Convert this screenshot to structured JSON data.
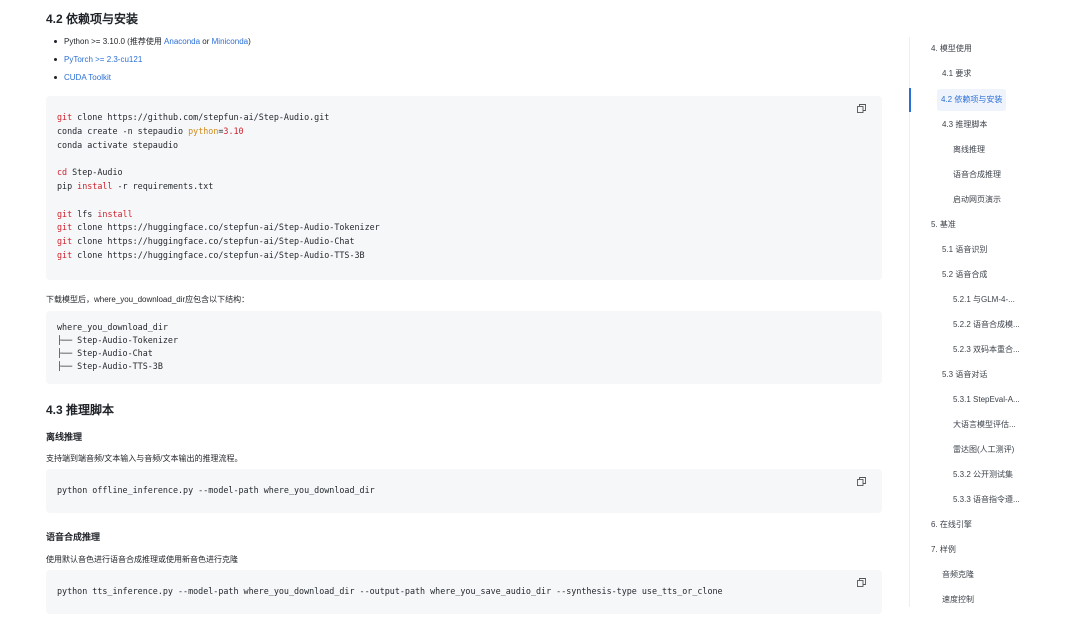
{
  "section_42": {
    "title": "4.2 依赖项与安装",
    "bullets": [
      {
        "prefix": "Python >= 3.10.0 (推荐使用 ",
        "link1": "Anaconda",
        "mid": " or ",
        "link2": "Miniconda",
        "suffix": ")"
      },
      {
        "link": "PyTorch >= 2.3-cu121"
      },
      {
        "link": "CUDA Toolkit"
      }
    ],
    "download_note": "下载模型后，where_you_download_dir应包含以下结构：",
    "tree": [
      "where_you_download_dir",
      "├── Step-Audio-Tokenizer",
      "├── Step-Audio-Chat",
      "├── Step-Audio-TTS-3B"
    ]
  },
  "install_code": {
    "l1_cmd": "git",
    "l1_rest": " clone https://github.com/stepfun-ai/Step-Audio.git",
    "l2_a": "conda create -n stepaudio ",
    "l2_kw": "python",
    "l2_eq": "=",
    "l2_num": "3.10",
    "l3": "conda activate stepaudio",
    "l4_cmd": "cd",
    "l4_rest": " Step-Audio",
    "l5_a": "pip ",
    "l5_kw": "install",
    "l5_rest": " -r requirements.txt",
    "l6_cmd": "git",
    "l6_rest": " lfs ",
    "l6_kw": "install",
    "l7_cmd": "git",
    "l7_rest": " clone https://huggingface.co/stepfun-ai/Step-Audio-Tokenizer",
    "l8_cmd": "git",
    "l8_rest": " clone https://huggingface.co/stepfun-ai/Step-Audio-Chat",
    "l9_cmd": "git",
    "l9_rest": " clone https://huggingface.co/stepfun-ai/Step-Audio-TTS-3B"
  },
  "section_43": {
    "title": "4.3 推理脚本",
    "offline_title": "离线推理",
    "offline_desc": "支持端到端音频/文本输入与音频/文本输出的推理流程。",
    "offline_cmd": "python offline_inference.py --model-path where_you_download_dir",
    "tts_title": "语音合成推理",
    "tts_desc": "使用默认音色进行语音合成推理或使用新音色进行克隆",
    "tts_cmd": "python tts_inference.py --model-path where_you_download_dir --output-path where_you_save_audio_dir --synthesis-type use_tts_or_clone"
  },
  "toc": [
    {
      "label": "4. 模型使用",
      "level": 0
    },
    {
      "label": "4.1 要求",
      "level": 1
    },
    {
      "label": "4.2 依赖项与安装",
      "level": 1,
      "active": true
    },
    {
      "label": "4.3 推理脚本",
      "level": 1
    },
    {
      "label": "离线推理",
      "level": 2
    },
    {
      "label": "语音合成推理",
      "level": 2
    },
    {
      "label": "启动网页演示",
      "level": 2
    },
    {
      "label": "5. 基准",
      "level": 0
    },
    {
      "label": "5.1 语音识别",
      "level": 1
    },
    {
      "label": "5.2 语音合成",
      "level": 1
    },
    {
      "label": "5.2.1 与GLM-4-...",
      "level": 2
    },
    {
      "label": "5.2.2 语音合成模...",
      "level": 2
    },
    {
      "label": "5.2.3 双码本重合...",
      "level": 2
    },
    {
      "label": "5.3 语音对话",
      "level": 1
    },
    {
      "label": "5.3.1 StepEval-A...",
      "level": 2
    },
    {
      "label": "大语言模型评估...",
      "level": 2
    },
    {
      "label": "雷达图(人工测评)",
      "level": 2
    },
    {
      "label": "5.3.2 公开测试集",
      "level": 2
    },
    {
      "label": "5.3.3 语音指令遵...",
      "level": 2
    },
    {
      "label": "6. 在线引擎",
      "level": 0
    },
    {
      "label": "7. 样例",
      "level": 0
    },
    {
      "label": "音频克隆",
      "level": 1
    },
    {
      "label": "速度控制",
      "level": 1
    }
  ],
  "colors": {
    "accent": "#2b6fd6",
    "code_bg": "#f6f7f8",
    "keyword": "#cf222e",
    "python_kw": "#d18b1c"
  },
  "icons": {
    "copy": "copy-icon"
  }
}
